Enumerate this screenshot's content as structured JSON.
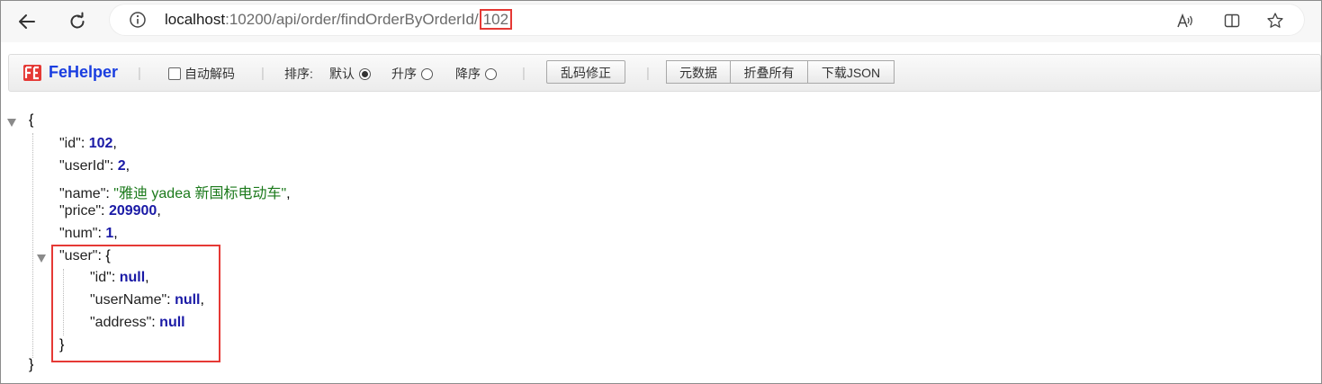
{
  "browser": {
    "url_host": "localhost",
    "url_path": ":10200/api/order/findOrderByOrderId/",
    "url_highlight": "102"
  },
  "fehelper": {
    "title": "FeHelper",
    "auto_decode_label": "自动解码",
    "sort_label": "排序:",
    "sort_default": "默认",
    "sort_asc": "升序",
    "sort_desc": "降序",
    "sort_selected": "默认",
    "fix_encoding": "乱码修正",
    "raw_data": "元数据",
    "collapse_all": "折叠所有",
    "download_json": "下载JSON"
  },
  "json_view": {
    "open_brace": "{",
    "close_brace": "}",
    "fields": [
      {
        "key": "\"id\"",
        "value": "102",
        "type": "number",
        "comma": ","
      },
      {
        "key": "\"userId\"",
        "value": "2",
        "type": "number",
        "comma": ","
      },
      {
        "key": "\"name\"",
        "value": "\"雅迪 yadea 新国标电动车\"",
        "type": "string",
        "comma": ","
      },
      {
        "key": "\"price\"",
        "value": "209900",
        "type": "number",
        "comma": ","
      },
      {
        "key": "\"num\"",
        "value": "1",
        "type": "number",
        "comma": ","
      }
    ],
    "user": {
      "key": "\"user\"",
      "open": "{",
      "close": "}",
      "fields": [
        {
          "key": "\"id\"",
          "value": "null",
          "comma": ","
        },
        {
          "key": "\"userName\"",
          "value": "null",
          "comma": ","
        },
        {
          "key": "\"address\"",
          "value": "null",
          "comma": ""
        }
      ]
    }
  },
  "colors": {
    "highlight_border": "#e53935",
    "json_number": "#1a1aa6",
    "json_string": "#1c7a1c",
    "fehelper_brand": "#1a3ee0"
  }
}
